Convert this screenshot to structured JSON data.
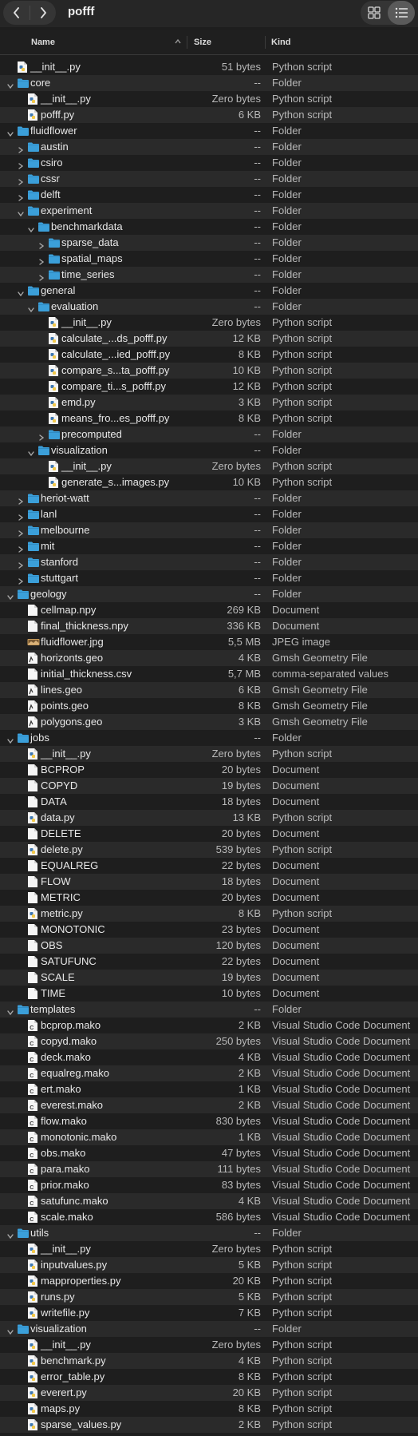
{
  "window": {
    "title": "pofff",
    "back_icon": "chevron-left-icon",
    "forward_icon": "chevron-right-icon",
    "grid_view_icon": "grid-icon",
    "list_view_icon": "list-icon"
  },
  "columns": {
    "name": "Name",
    "size": "Size",
    "kind": "Kind"
  },
  "colors": {
    "background": "#1e1e1e",
    "alt_row": "#2a2a2a",
    "folder": "#3b9fd9",
    "text": "#e8e8e8",
    "secondary": "#b8b8b8"
  },
  "rows": [
    {
      "name": "__init__.py",
      "size": "51 bytes",
      "kind": "Python script",
      "depth": 0,
      "type": "py"
    },
    {
      "name": "core",
      "size": "--",
      "kind": "Folder",
      "depth": 0,
      "type": "folder",
      "open": true
    },
    {
      "name": "__init__.py",
      "size": "Zero bytes",
      "kind": "Python script",
      "depth": 1,
      "type": "py"
    },
    {
      "name": "pofff.py",
      "size": "6 KB",
      "kind": "Python script",
      "depth": 1,
      "type": "py"
    },
    {
      "name": "fluidflower",
      "size": "--",
      "kind": "Folder",
      "depth": 0,
      "type": "folder",
      "open": true
    },
    {
      "name": "austin",
      "size": "--",
      "kind": "Folder",
      "depth": 1,
      "type": "folder",
      "open": false
    },
    {
      "name": "csiro",
      "size": "--",
      "kind": "Folder",
      "depth": 1,
      "type": "folder",
      "open": false
    },
    {
      "name": "cssr",
      "size": "--",
      "kind": "Folder",
      "depth": 1,
      "type": "folder",
      "open": false
    },
    {
      "name": "delft",
      "size": "--",
      "kind": "Folder",
      "depth": 1,
      "type": "folder",
      "open": false
    },
    {
      "name": "experiment",
      "size": "--",
      "kind": "Folder",
      "depth": 1,
      "type": "folder",
      "open": true
    },
    {
      "name": "benchmarkdata",
      "size": "--",
      "kind": "Folder",
      "depth": 2,
      "type": "folder",
      "open": true
    },
    {
      "name": "sparse_data",
      "size": "--",
      "kind": "Folder",
      "depth": 3,
      "type": "folder",
      "open": false
    },
    {
      "name": "spatial_maps",
      "size": "--",
      "kind": "Folder",
      "depth": 3,
      "type": "folder",
      "open": false
    },
    {
      "name": "time_series",
      "size": "--",
      "kind": "Folder",
      "depth": 3,
      "type": "folder",
      "open": false
    },
    {
      "name": "general",
      "size": "--",
      "kind": "Folder",
      "depth": 1,
      "type": "folder",
      "open": true
    },
    {
      "name": "evaluation",
      "size": "--",
      "kind": "Folder",
      "depth": 2,
      "type": "folder",
      "open": true
    },
    {
      "name": "__init__.py",
      "size": "Zero bytes",
      "kind": "Python script",
      "depth": 3,
      "type": "py"
    },
    {
      "name": "calculate_...ds_pofff.py",
      "size": "12 KB",
      "kind": "Python script",
      "depth": 3,
      "type": "py"
    },
    {
      "name": "calculate_...ied_pofff.py",
      "size": "8 KB",
      "kind": "Python script",
      "depth": 3,
      "type": "py"
    },
    {
      "name": "compare_s...ta_pofff.py",
      "size": "10 KB",
      "kind": "Python script",
      "depth": 3,
      "type": "py"
    },
    {
      "name": "compare_ti...s_pofff.py",
      "size": "12 KB",
      "kind": "Python script",
      "depth": 3,
      "type": "py"
    },
    {
      "name": "emd.py",
      "size": "3 KB",
      "kind": "Python script",
      "depth": 3,
      "type": "py"
    },
    {
      "name": "means_fro...es_pofff.py",
      "size": "8 KB",
      "kind": "Python script",
      "depth": 3,
      "type": "py"
    },
    {
      "name": "precomputed",
      "size": "--",
      "kind": "Folder",
      "depth": 3,
      "type": "folder",
      "open": false
    },
    {
      "name": "visualization",
      "size": "--",
      "kind": "Folder",
      "depth": 2,
      "type": "folder",
      "open": true
    },
    {
      "name": "__init__.py",
      "size": "Zero bytes",
      "kind": "Python script",
      "depth": 3,
      "type": "py"
    },
    {
      "name": "generate_s...images.py",
      "size": "10 KB",
      "kind": "Python script",
      "depth": 3,
      "type": "py"
    },
    {
      "name": "heriot-watt",
      "size": "--",
      "kind": "Folder",
      "depth": 1,
      "type": "folder",
      "open": false
    },
    {
      "name": "lanl",
      "size": "--",
      "kind": "Folder",
      "depth": 1,
      "type": "folder",
      "open": false
    },
    {
      "name": "melbourne",
      "size": "--",
      "kind": "Folder",
      "depth": 1,
      "type": "folder",
      "open": false
    },
    {
      "name": "mit",
      "size": "--",
      "kind": "Folder",
      "depth": 1,
      "type": "folder",
      "open": false
    },
    {
      "name": "stanford",
      "size": "--",
      "kind": "Folder",
      "depth": 1,
      "type": "folder",
      "open": false
    },
    {
      "name": "stuttgart",
      "size": "--",
      "kind": "Folder",
      "depth": 1,
      "type": "folder",
      "open": false
    },
    {
      "name": "geology",
      "size": "--",
      "kind": "Folder",
      "depth": 0,
      "type": "folder",
      "open": true
    },
    {
      "name": "cellmap.npy",
      "size": "269 KB",
      "kind": "Document",
      "depth": 1,
      "type": "doc"
    },
    {
      "name": "final_thickness.npy",
      "size": "336 KB",
      "kind": "Document",
      "depth": 1,
      "type": "doc"
    },
    {
      "name": "fluidflower.jpg",
      "size": "5,5 MB",
      "kind": "JPEG image",
      "depth": 1,
      "type": "img"
    },
    {
      "name": "horizonts.geo",
      "size": "4 KB",
      "kind": "Gmsh Geometry File",
      "depth": 1,
      "type": "geo"
    },
    {
      "name": "initial_thickness.csv",
      "size": "5,7 MB",
      "kind": "comma-separated values",
      "depth": 1,
      "type": "doc"
    },
    {
      "name": "lines.geo",
      "size": "6 KB",
      "kind": "Gmsh Geometry File",
      "depth": 1,
      "type": "geo"
    },
    {
      "name": "points.geo",
      "size": "8 KB",
      "kind": "Gmsh Geometry File",
      "depth": 1,
      "type": "geo"
    },
    {
      "name": "polygons.geo",
      "size": "3 KB",
      "kind": "Gmsh Geometry File",
      "depth": 1,
      "type": "geo"
    },
    {
      "name": "jobs",
      "size": "--",
      "kind": "Folder",
      "depth": 0,
      "type": "folder",
      "open": true
    },
    {
      "name": "__init__.py",
      "size": "Zero bytes",
      "kind": "Python script",
      "depth": 1,
      "type": "py"
    },
    {
      "name": "BCPROP",
      "size": "20 bytes",
      "kind": "Document",
      "depth": 1,
      "type": "doc"
    },
    {
      "name": "COPYD",
      "size": "19 bytes",
      "kind": "Document",
      "depth": 1,
      "type": "doc"
    },
    {
      "name": "DATA",
      "size": "18 bytes",
      "kind": "Document",
      "depth": 1,
      "type": "doc"
    },
    {
      "name": "data.py",
      "size": "13 KB",
      "kind": "Python script",
      "depth": 1,
      "type": "py"
    },
    {
      "name": "DELETE",
      "size": "20 bytes",
      "kind": "Document",
      "depth": 1,
      "type": "doc"
    },
    {
      "name": "delete.py",
      "size": "539 bytes",
      "kind": "Python script",
      "depth": 1,
      "type": "py"
    },
    {
      "name": "EQUALREG",
      "size": "22 bytes",
      "kind": "Document",
      "depth": 1,
      "type": "doc"
    },
    {
      "name": "FLOW",
      "size": "18 bytes",
      "kind": "Document",
      "depth": 1,
      "type": "doc"
    },
    {
      "name": "METRIC",
      "size": "20 bytes",
      "kind": "Document",
      "depth": 1,
      "type": "doc"
    },
    {
      "name": "metric.py",
      "size": "8 KB",
      "kind": "Python script",
      "depth": 1,
      "type": "py"
    },
    {
      "name": "MONOTONIC",
      "size": "23 bytes",
      "kind": "Document",
      "depth": 1,
      "type": "doc"
    },
    {
      "name": "OBS",
      "size": "120 bytes",
      "kind": "Document",
      "depth": 1,
      "type": "doc"
    },
    {
      "name": "SATUFUNC",
      "size": "22 bytes",
      "kind": "Document",
      "depth": 1,
      "type": "doc"
    },
    {
      "name": "SCALE",
      "size": "19 bytes",
      "kind": "Document",
      "depth": 1,
      "type": "doc"
    },
    {
      "name": "TIME",
      "size": "10 bytes",
      "kind": "Document",
      "depth": 1,
      "type": "doc"
    },
    {
      "name": "templates",
      "size": "--",
      "kind": "Folder",
      "depth": 0,
      "type": "folder",
      "open": true
    },
    {
      "name": "bcprop.mako",
      "size": "2 KB",
      "kind": "Visual Studio Code Document",
      "depth": 1,
      "type": "code"
    },
    {
      "name": "copyd.mako",
      "size": "250 bytes",
      "kind": "Visual Studio Code Document",
      "depth": 1,
      "type": "code"
    },
    {
      "name": "deck.mako",
      "size": "4 KB",
      "kind": "Visual Studio Code Document",
      "depth": 1,
      "type": "code"
    },
    {
      "name": "equalreg.mako",
      "size": "2 KB",
      "kind": "Visual Studio Code Document",
      "depth": 1,
      "type": "code"
    },
    {
      "name": "ert.mako",
      "size": "1 KB",
      "kind": "Visual Studio Code Document",
      "depth": 1,
      "type": "code"
    },
    {
      "name": "everest.mako",
      "size": "2 KB",
      "kind": "Visual Studio Code Document",
      "depth": 1,
      "type": "code"
    },
    {
      "name": "flow.mako",
      "size": "830 bytes",
      "kind": "Visual Studio Code Document",
      "depth": 1,
      "type": "code"
    },
    {
      "name": "monotonic.mako",
      "size": "1 KB",
      "kind": "Visual Studio Code Document",
      "depth": 1,
      "type": "code"
    },
    {
      "name": "obs.mako",
      "size": "47 bytes",
      "kind": "Visual Studio Code Document",
      "depth": 1,
      "type": "code"
    },
    {
      "name": "para.mako",
      "size": "111 bytes",
      "kind": "Visual Studio Code Document",
      "depth": 1,
      "type": "code"
    },
    {
      "name": "prior.mako",
      "size": "83 bytes",
      "kind": "Visual Studio Code Document",
      "depth": 1,
      "type": "code"
    },
    {
      "name": "satufunc.mako",
      "size": "4 KB",
      "kind": "Visual Studio Code Document",
      "depth": 1,
      "type": "code"
    },
    {
      "name": "scale.mako",
      "size": "586 bytes",
      "kind": "Visual Studio Code Document",
      "depth": 1,
      "type": "code"
    },
    {
      "name": "utils",
      "size": "--",
      "kind": "Folder",
      "depth": 0,
      "type": "folder",
      "open": true
    },
    {
      "name": "__init__.py",
      "size": "Zero bytes",
      "kind": "Python script",
      "depth": 1,
      "type": "py"
    },
    {
      "name": "inputvalues.py",
      "size": "5 KB",
      "kind": "Python script",
      "depth": 1,
      "type": "py"
    },
    {
      "name": "mapproperties.py",
      "size": "20 KB",
      "kind": "Python script",
      "depth": 1,
      "type": "py"
    },
    {
      "name": "runs.py",
      "size": "5 KB",
      "kind": "Python script",
      "depth": 1,
      "type": "py"
    },
    {
      "name": "writefile.py",
      "size": "7 KB",
      "kind": "Python script",
      "depth": 1,
      "type": "py"
    },
    {
      "name": "visualization",
      "size": "--",
      "kind": "Folder",
      "depth": 0,
      "type": "folder",
      "open": true
    },
    {
      "name": "__init__.py",
      "size": "Zero bytes",
      "kind": "Python script",
      "depth": 1,
      "type": "py"
    },
    {
      "name": "benchmark.py",
      "size": "4 KB",
      "kind": "Python script",
      "depth": 1,
      "type": "py"
    },
    {
      "name": "error_table.py",
      "size": "8 KB",
      "kind": "Python script",
      "depth": 1,
      "type": "py"
    },
    {
      "name": "everert.py",
      "size": "20 KB",
      "kind": "Python script",
      "depth": 1,
      "type": "py"
    },
    {
      "name": "maps.py",
      "size": "8 KB",
      "kind": "Python script",
      "depth": 1,
      "type": "py"
    },
    {
      "name": "sparse_values.py",
      "size": "2 KB",
      "kind": "Python script",
      "depth": 1,
      "type": "py"
    }
  ]
}
